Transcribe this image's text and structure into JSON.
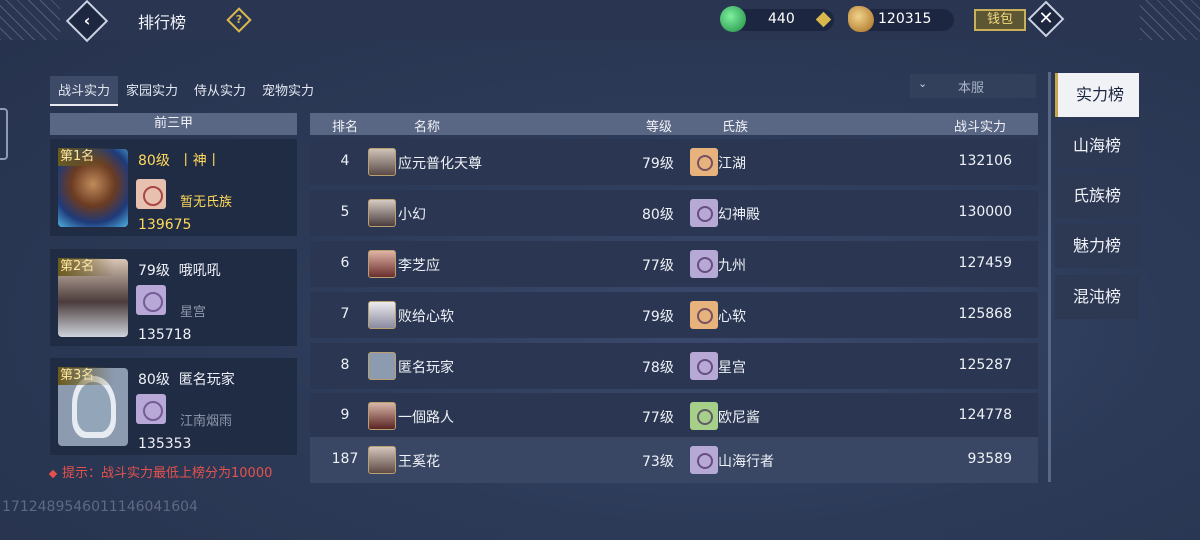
{
  "header": {
    "title": "排行榜",
    "back_label": "‹",
    "help_label": "?",
    "jade_value": "440",
    "gold_value": "120315",
    "wallet_label": "钱包",
    "close_label": "✕"
  },
  "tabs": [
    {
      "label": "战斗实力",
      "active": true
    },
    {
      "label": "家园实力",
      "active": false
    },
    {
      "label": "侍从实力",
      "active": false
    },
    {
      "label": "宠物实力",
      "active": false
    }
  ],
  "server_select": {
    "value": "本服"
  },
  "top_three": {
    "header": "前三甲",
    "cards": [
      {
        "rank": "第1名",
        "level": "80级",
        "name": "丨神丨",
        "clan": "暂无氏族",
        "power": "139675"
      },
      {
        "rank": "第2名",
        "level": "79级",
        "name": "哦吼吼",
        "clan": "星宫",
        "power": "135718"
      },
      {
        "rank": "第3名",
        "level": "80级",
        "name": "匿名玩家",
        "clan": "江南烟雨",
        "power": "135353"
      }
    ]
  },
  "tip": "提示：战斗实力最低上榜分为10000",
  "uid": "1712489546011146041604",
  "table": {
    "columns": [
      "排名",
      "名称",
      "等级",
      "氏族",
      "战斗实力"
    ],
    "rows": [
      {
        "rank": "4",
        "name": "应元普化天尊",
        "level": "79级",
        "clan": "江湖",
        "power": "132106",
        "clan_color": "orange"
      },
      {
        "rank": "5",
        "name": "小幻",
        "level": "80级",
        "clan": "幻神殿",
        "power": "130000",
        "clan_color": "purple"
      },
      {
        "rank": "6",
        "name": "李芝应",
        "level": "77级",
        "clan": "九州",
        "power": "127459",
        "clan_color": "purple"
      },
      {
        "rank": "7",
        "name": "败给心软",
        "level": "79级",
        "clan": "心软",
        "power": "125868",
        "clan_color": "orange"
      },
      {
        "rank": "8",
        "name": "匿名玩家",
        "level": "78级",
        "clan": "星宫",
        "power": "125287",
        "clan_color": "purple"
      },
      {
        "rank": "9",
        "name": "一個路人",
        "level": "77级",
        "clan": "欧尼酱",
        "power": "124778",
        "clan_color": "green"
      }
    ],
    "my_row": {
      "rank": "187",
      "name": "王奚花",
      "level": "73级",
      "clan": "山海行者",
      "power": "93589",
      "clan_color": "purple"
    }
  },
  "side_nav": [
    {
      "label": "实力榜",
      "active": true
    },
    {
      "label": "山海榜",
      "active": false
    },
    {
      "label": "氏族榜",
      "active": false
    },
    {
      "label": "魅力榜",
      "active": false
    },
    {
      "label": "混沌榜",
      "active": false
    }
  ]
}
